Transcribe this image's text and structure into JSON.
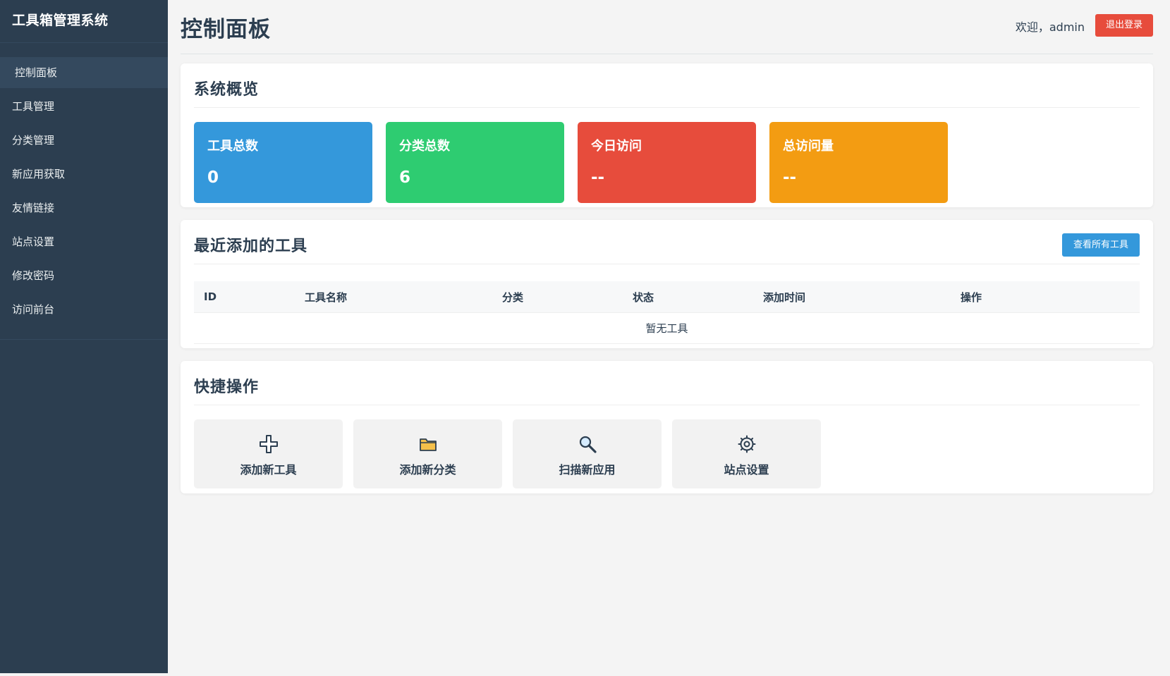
{
  "app": {
    "title": "工具箱管理系统"
  },
  "sidebar": {
    "items": [
      {
        "label": "控制面板",
        "active": true
      },
      {
        "label": "工具管理",
        "active": false
      },
      {
        "label": "分类管理",
        "active": false
      },
      {
        "label": "新应用获取",
        "active": false
      },
      {
        "label": "友情链接",
        "active": false
      },
      {
        "label": "站点设置",
        "active": false
      },
      {
        "label": "修改密码",
        "active": false
      },
      {
        "label": "访问前台",
        "active": false
      }
    ]
  },
  "header": {
    "page_title": "控制面板",
    "welcome": "欢迎，admin",
    "logout_label": "退出登录"
  },
  "overview": {
    "title": "系统概览",
    "stats": [
      {
        "label": "工具总数",
        "value": "0",
        "color": "#3498db"
      },
      {
        "label": "分类总数",
        "value": "6",
        "color": "#2ecc71"
      },
      {
        "label": "今日访问",
        "value": "--",
        "color": "#e74c3c"
      },
      {
        "label": "总访问量",
        "value": "--",
        "color": "#f39c12"
      }
    ]
  },
  "recent": {
    "title": "最近添加的工具",
    "view_all_label": "查看所有工具",
    "columns": [
      "ID",
      "工具名称",
      "分类",
      "状态",
      "添加时间",
      "操作"
    ],
    "empty_text": "暂无工具"
  },
  "quick": {
    "title": "快捷操作",
    "actions": [
      {
        "label": "添加新工具",
        "icon": "plus-icon"
      },
      {
        "label": "添加新分类",
        "icon": "folder-icon"
      },
      {
        "label": "扫描新应用",
        "icon": "magnifier-icon"
      },
      {
        "label": "站点设置",
        "icon": "gear-icon"
      }
    ]
  },
  "colors": {
    "sidebar_bg": "#2c3e50",
    "logout": "#e74c3c",
    "primary": "#3498db"
  }
}
